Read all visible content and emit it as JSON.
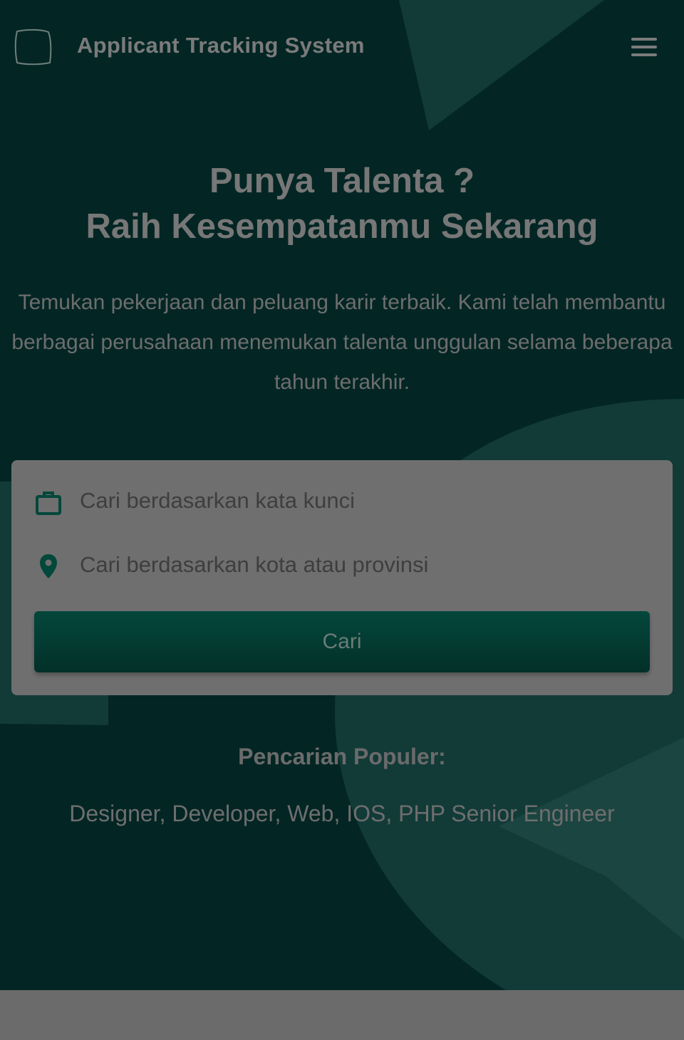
{
  "navbar": {
    "brand": "Applicant Tracking System",
    "logo_icon": "rounded-square-logo-icon",
    "menu_icon": "hamburger-menu-icon"
  },
  "hero": {
    "headline_line1": "Punya Talenta ?",
    "headline_line2": "Raih Kesempatanmu Sekarang",
    "description": "Temukan pekerjaan dan peluang karir terbaik. Kami telah membantu berbagai perusahaan menemukan talenta unggulan selama beberapa tahun terakhir."
  },
  "search": {
    "keyword_placeholder": "Cari berdasarkan kata kunci",
    "keyword_value": "",
    "keyword_icon": "briefcase-icon",
    "location_placeholder": "Cari berdasarkan kota atau provinsi",
    "location_value": "",
    "location_icon": "map-pin-icon",
    "button_label": "Cari"
  },
  "popular": {
    "title": "Pencarian Populer:",
    "items": [
      "Designer",
      "Developer",
      "Web",
      "IOS",
      "PHP Senior Engineer"
    ]
  },
  "colors": {
    "background": "#032624",
    "decoration": "#123b38",
    "accent": "#04473b",
    "icon": "#04473b"
  }
}
